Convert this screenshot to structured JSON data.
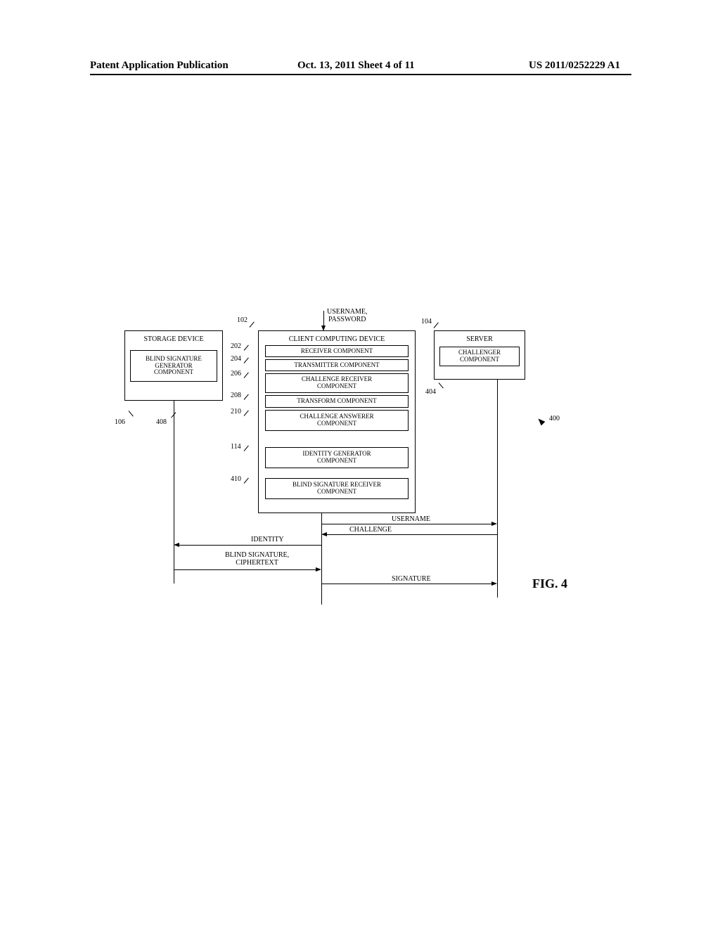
{
  "header": {
    "left": "Patent Application Publication",
    "center": "Oct. 13, 2011  Sheet 4 of 11",
    "right": "US 2011/0252229 A1"
  },
  "input_label": "USERNAME,\nPASSWORD",
  "storage": {
    "title": "STORAGE DEVICE",
    "inner": "BLIND SIGNATURE\nGENERATOR\nCOMPONENT"
  },
  "client": {
    "title": "CLIENT COMPUTING DEVICE",
    "c1": "RECEIVER COMPONENT",
    "c2": "TRANSMITTER COMPONENT",
    "c3": "CHALLENGE RECEIVER\nCOMPONENT",
    "c4": "TRANSFORM COMPONENT",
    "c5": "CHALLENGE ANSWERER\nCOMPONENT",
    "c6": "IDENTITY GENERATOR\nCOMPONENT",
    "c7": "BLIND SIGNATURE RECEIVER\nCOMPONENT"
  },
  "server": {
    "title": "SERVER",
    "inner": "CHALLENGER\nCOMPONENT"
  },
  "flows": {
    "username": "USERNAME",
    "challenge": "CHALLENGE",
    "identity": "IDENTITY",
    "blind_sig": "BLIND SIGNATURE,\nCIPHERTEXT",
    "signature": "SIGNATURE"
  },
  "refs": {
    "r102": "102",
    "r104": "104",
    "r106": "106",
    "r114": "114",
    "r202": "202",
    "r204": "204",
    "r206": "206",
    "r208": "208",
    "r210": "210",
    "r400": "400",
    "r404": "404",
    "r408": "408",
    "r410": "410"
  },
  "fig": "FIG. 4"
}
